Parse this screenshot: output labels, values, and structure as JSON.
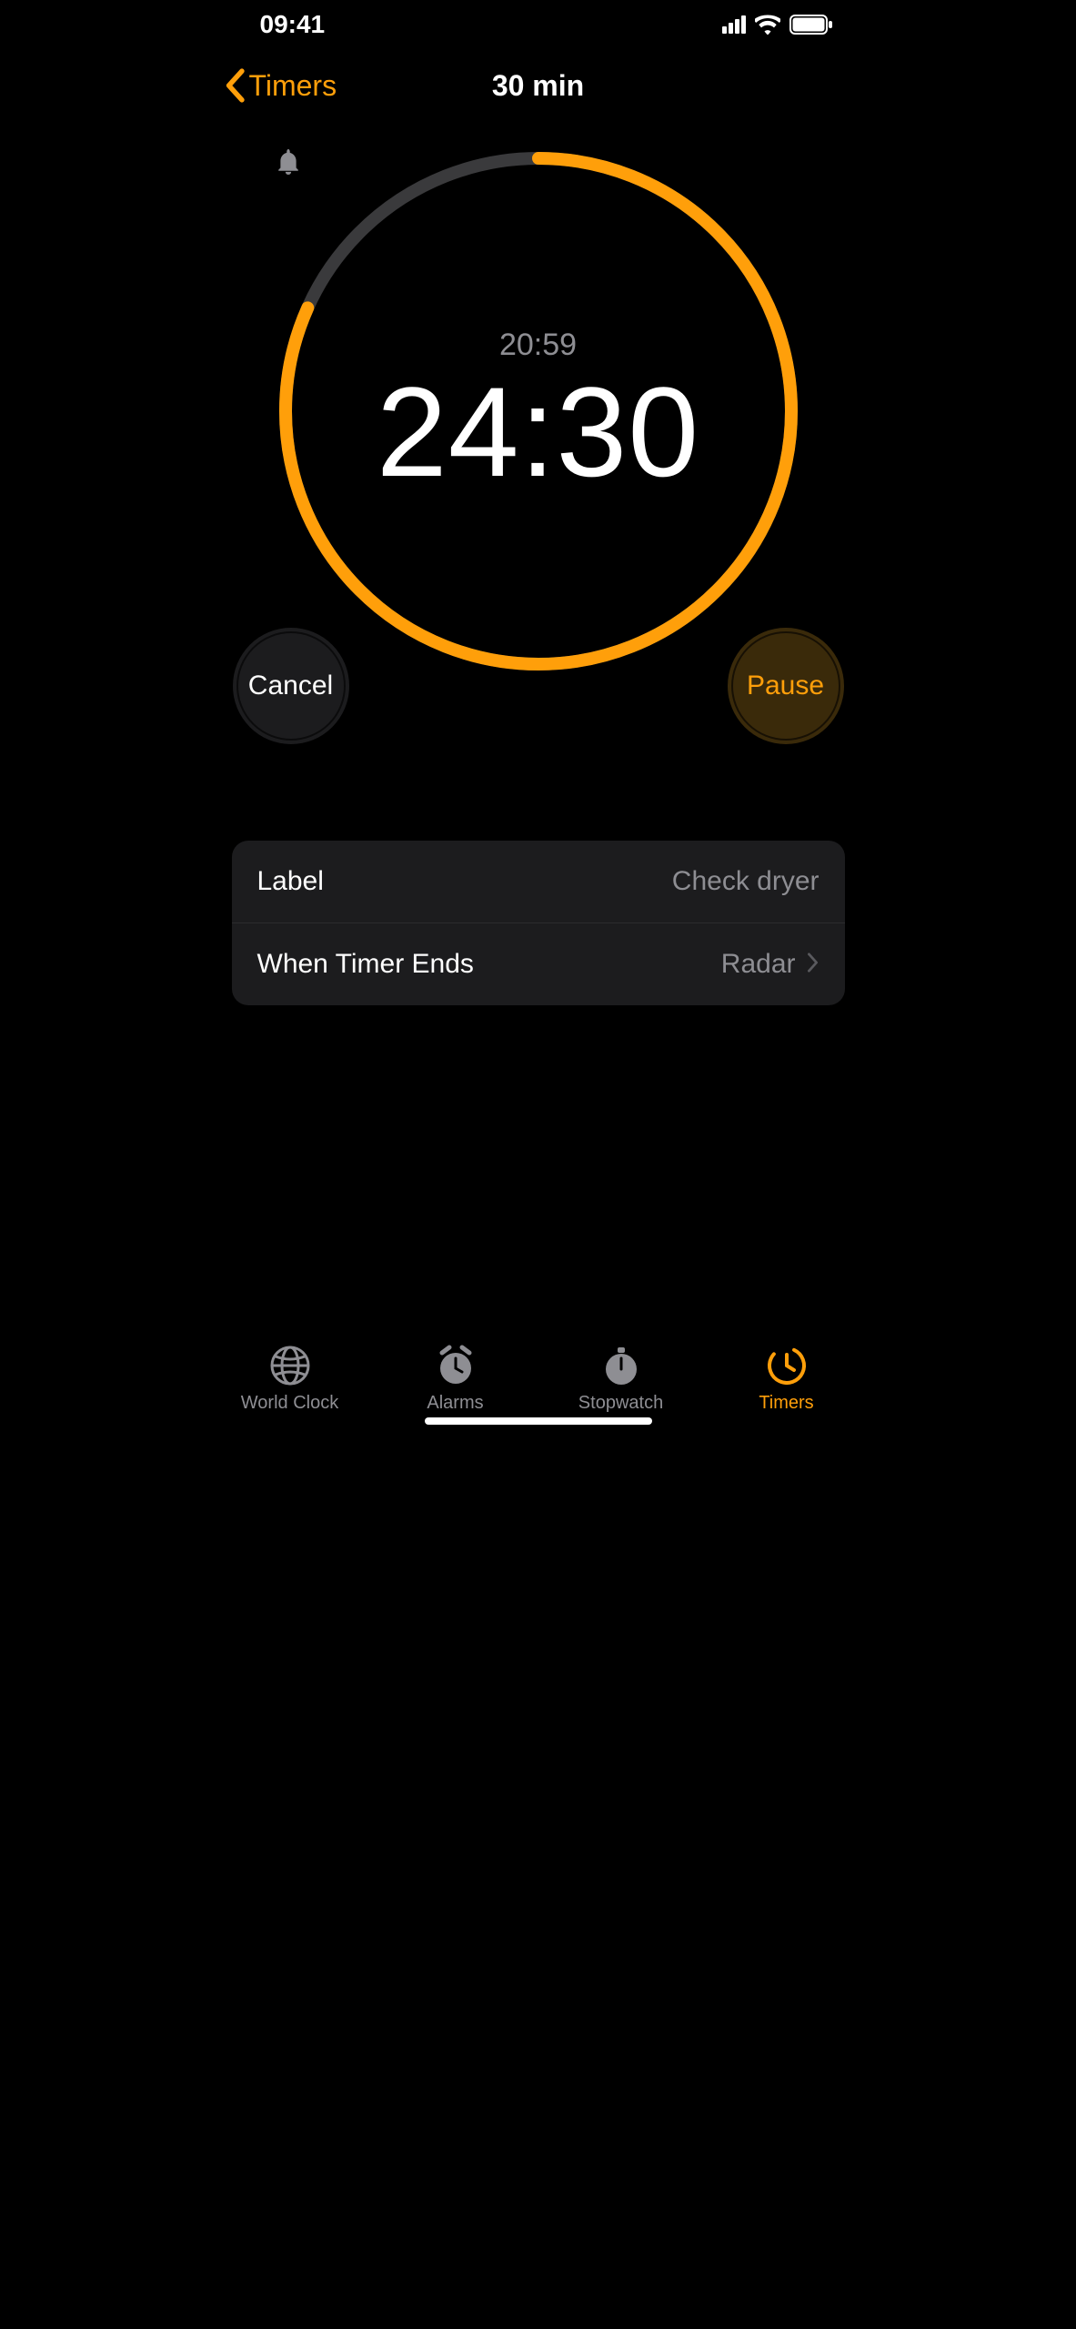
{
  "statusbar": {
    "time": "09:41"
  },
  "nav": {
    "back_label": "Timers",
    "title": "30 min"
  },
  "timer": {
    "end_time": "20:59",
    "remaining": "24:30",
    "progress_fraction": 0.817
  },
  "buttons": {
    "cancel": "Cancel",
    "pause": "Pause"
  },
  "settings": {
    "label_title": "Label",
    "label_value": "Check dryer",
    "end_title": "When Timer Ends",
    "end_value": "Radar"
  },
  "tabs": {
    "world_clock": "World Clock",
    "alarms": "Alarms",
    "stopwatch": "Stopwatch",
    "timers": "Timers"
  }
}
